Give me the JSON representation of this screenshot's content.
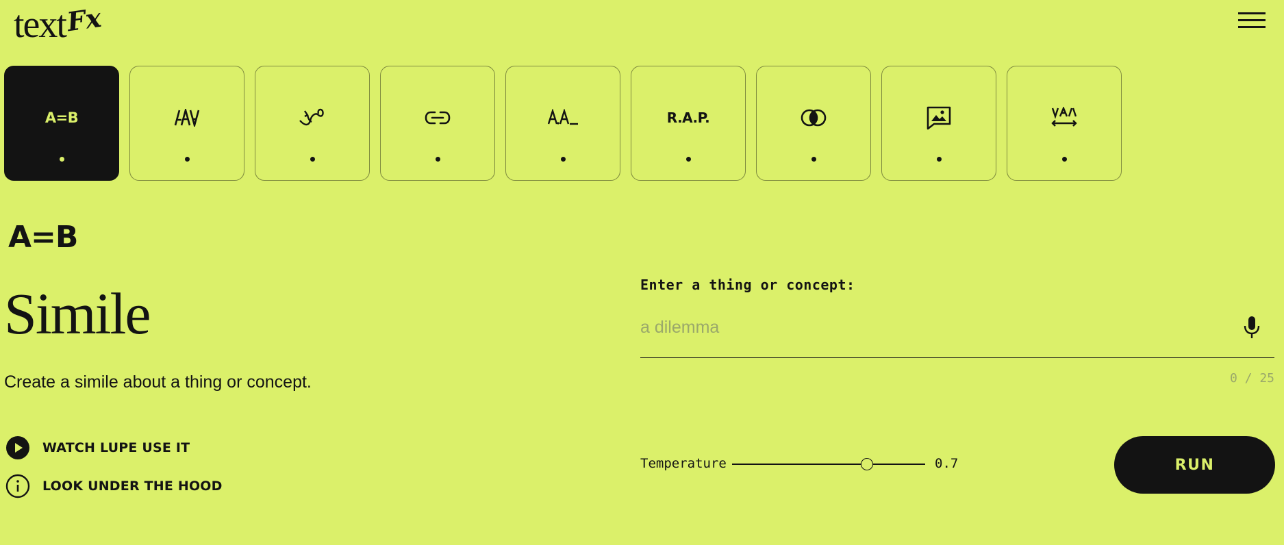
{
  "header": {
    "logo_main": "text",
    "logo_fx": "Fx",
    "menu_icon": "hamburger-menu-icon"
  },
  "tools": [
    {
      "id": "simile",
      "label": "A=B",
      "icon": "simile-icon",
      "active": true
    },
    {
      "id": "unexpect",
      "label": "",
      "icon": "unexpect-icon",
      "active": false
    },
    {
      "id": "unfold",
      "label": "",
      "icon": "unfold-icon",
      "active": false
    },
    {
      "id": "chain",
      "label": "",
      "icon": "chain-icon",
      "active": false
    },
    {
      "id": "alliteration",
      "label": "",
      "icon": "alliteration-icon",
      "active": false
    },
    {
      "id": "acronym",
      "label": "R.A.P.",
      "icon": "acronym-icon",
      "active": false
    },
    {
      "id": "fuse",
      "label": "",
      "icon": "fuse-icon",
      "active": false
    },
    {
      "id": "scene",
      "label": "",
      "icon": "scene-icon",
      "active": false
    },
    {
      "id": "antonym",
      "label": "",
      "icon": "antonym-icon",
      "active": false
    }
  ],
  "tool": {
    "code": "A=B",
    "title": "Simile",
    "description": "Create a simile about a thing or concept."
  },
  "actions": [
    {
      "label": "WATCH LUPE USE IT",
      "icon": "play-icon"
    },
    {
      "label": "LOOK UNDER THE HOOD",
      "icon": "info-icon"
    }
  ],
  "input": {
    "label": "Enter a thing or concept:",
    "placeholder": "a dilemma",
    "value": "",
    "counter": "0 / 25",
    "icon": "microphone-icon"
  },
  "temperature": {
    "label": "Temperature",
    "value": 0.7,
    "value_text": "0.7",
    "min": 0,
    "max": 1
  },
  "run_label": "RUN",
  "colors": {
    "background": "#dbf06a",
    "ink": "#131313",
    "muted": "#9aa86a"
  }
}
